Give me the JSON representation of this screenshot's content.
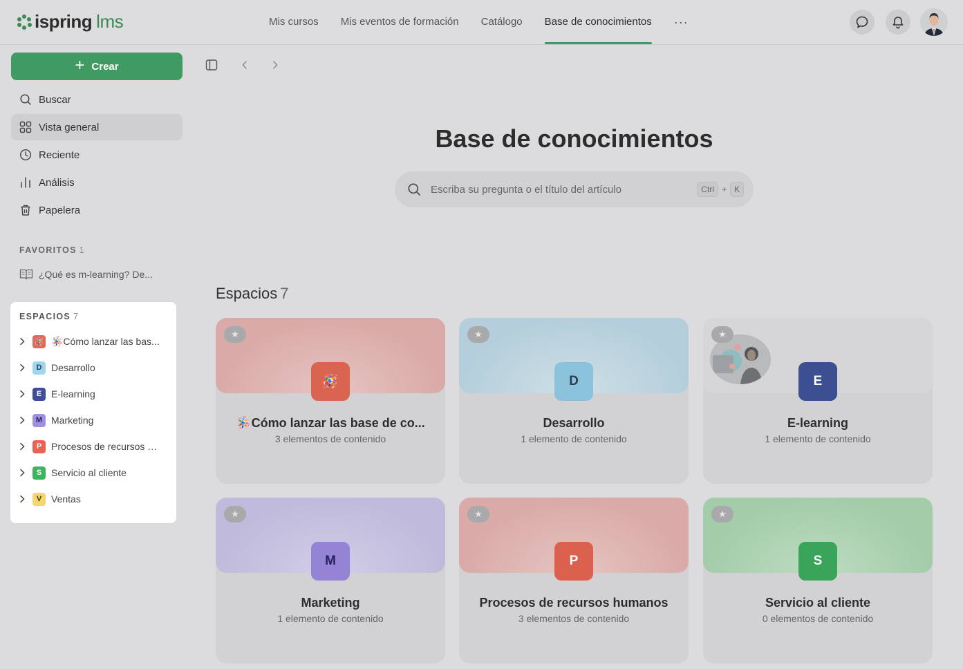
{
  "brand": {
    "name": "ispring",
    "suffix": "lms",
    "accent": "#3f9b62"
  },
  "nav": {
    "items": [
      {
        "label": "Mis cursos"
      },
      {
        "label": "Mis eventos de formación"
      },
      {
        "label": "Catálogo"
      },
      {
        "label": "Base de conocimientos"
      }
    ],
    "more": "···",
    "active_index": 3
  },
  "header": {
    "chat_icon": "chat-icon",
    "bell_icon": "bell-icon",
    "avatar": "user-avatar"
  },
  "sidebar": {
    "create_label": "Crear",
    "items": [
      {
        "label": "Buscar",
        "icon": "search-icon"
      },
      {
        "label": "Vista general",
        "icon": "grid-icon"
      },
      {
        "label": "Reciente",
        "icon": "clock-icon"
      },
      {
        "label": "Análisis",
        "icon": "bar-chart-icon"
      },
      {
        "label": "Papelera",
        "icon": "trash-icon"
      }
    ],
    "active_index": 1,
    "favorites": {
      "label": "FAVORITOS",
      "count": "1",
      "items": [
        {
          "label": "¿Qué es m-learning? De..."
        }
      ]
    },
    "spaces": {
      "label": "ESPACIOS",
      "count": "7",
      "items": [
        {
          "badge": "🪅",
          "label": "🪅Cómo lanzar las bas...",
          "color": "#e06a57"
        },
        {
          "badge": "D",
          "label": "Desarrollo",
          "color": "#9fd6ef"
        },
        {
          "badge": "E",
          "label": "E-learning",
          "color": "#3d4f96"
        },
        {
          "badge": "M",
          "label": "Marketing",
          "color": "#a18fe0"
        },
        {
          "badge": "P",
          "label": "Procesos de recursos h...",
          "color": "#e86352"
        },
        {
          "badge": "S",
          "label": "Servicio al cliente",
          "color": "#3cb45e"
        },
        {
          "badge": "V",
          "label": "Ventas",
          "color": "#f4d66d"
        }
      ]
    }
  },
  "main": {
    "title": "Base de conocimientos",
    "search": {
      "placeholder": "Escriba su pregunta o el título del artículo",
      "kbd_1": "Ctrl",
      "kbd_plus": "+",
      "kbd_2": "K"
    },
    "spaces_title": "Espacios",
    "spaces_count": "7",
    "cards": [
      {
        "name": "🪅Cómo lanzar las base de co...",
        "sub": "3 elementos de contenido",
        "letter": "🪅",
        "cover": "#d9aaa7",
        "tile": "#d9644f",
        "fg": "#ffffff"
      },
      {
        "name": "Desarrollo",
        "sub": "1 elemento de contenido",
        "letter": "D",
        "cover": "#b4cfdb",
        "tile": "#8cc3dc",
        "fg": "#2b3e52"
      },
      {
        "name": "E-learning",
        "sub": "1 elemento de contenido",
        "letter": "E",
        "cover": "#d6d6d8",
        "tile": "#3c4f91",
        "fg": "#ffffff"
      },
      {
        "name": "Marketing",
        "sub": "1 elemento de contenido",
        "letter": "M",
        "cover": "#c0badc",
        "tile": "#9584d6",
        "fg": "#2a2060"
      },
      {
        "name": "Procesos de recursos humanos",
        "sub": "3 elementos de contenido",
        "letter": "P",
        "cover": "#d9aaa7",
        "tile": "#dc604e",
        "fg": "#ffffff"
      },
      {
        "name": "Servicio al cliente",
        "sub": "0 elementos de contenido",
        "letter": "S",
        "cover": "#a3cca9",
        "tile": "#3aa55a",
        "fg": "#ffffff"
      }
    ]
  }
}
